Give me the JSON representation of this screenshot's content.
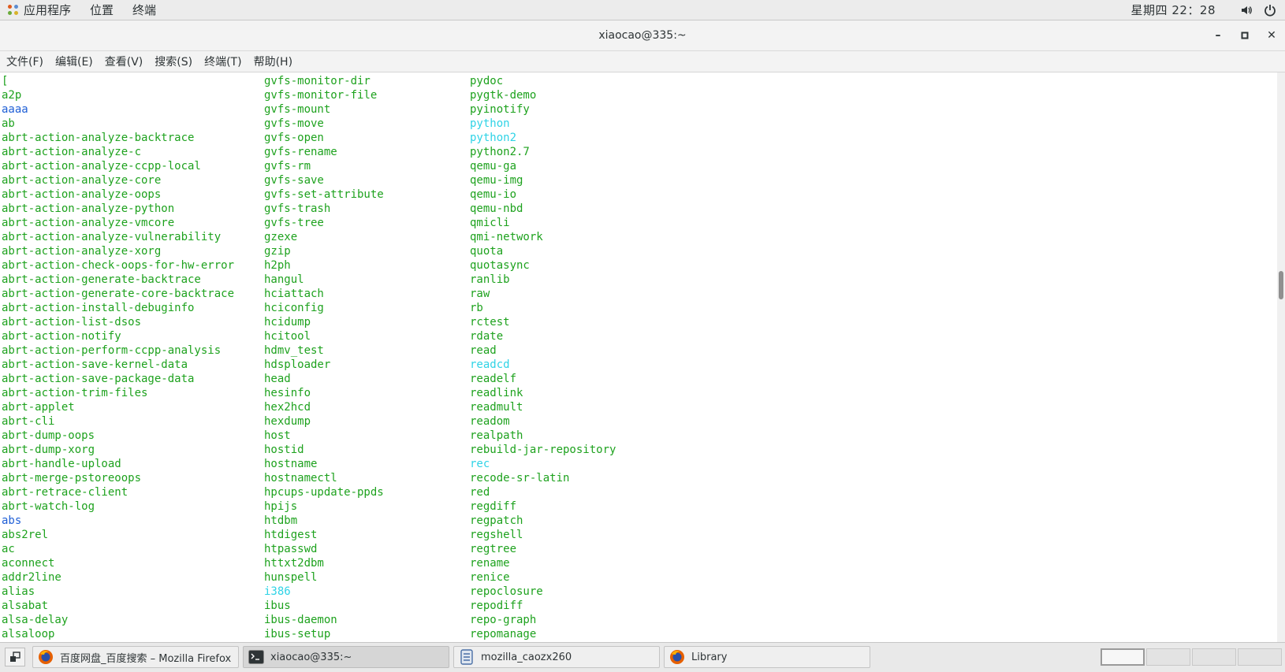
{
  "top_panel": {
    "apps_label": "应用程序",
    "places_label": "位置",
    "terminal_label": "终端",
    "clock": "星期四 22：28"
  },
  "window": {
    "title": "xiaocao@335:~",
    "minimize": "–",
    "maximize": "▫",
    "close": "✕"
  },
  "menubar": {
    "items": [
      "文件(F)",
      "编辑(E)",
      "查看(V)",
      "搜索(S)",
      "终端(T)",
      "帮助(H)"
    ]
  },
  "terminal": {
    "colors": {
      "green": "#1ea21e",
      "blue": "#1f5fd6",
      "cyan": "#2fd3e6"
    },
    "columns": [
      [
        {
          "t": "[",
          "c": "green"
        },
        {
          "t": "a2p",
          "c": "green"
        },
        {
          "t": "aaaa",
          "c": "blue"
        },
        {
          "t": "ab",
          "c": "green"
        },
        {
          "t": "abrt-action-analyze-backtrace",
          "c": "green"
        },
        {
          "t": "abrt-action-analyze-c",
          "c": "green"
        },
        {
          "t": "abrt-action-analyze-ccpp-local",
          "c": "green"
        },
        {
          "t": "abrt-action-analyze-core",
          "c": "green"
        },
        {
          "t": "abrt-action-analyze-oops",
          "c": "green"
        },
        {
          "t": "abrt-action-analyze-python",
          "c": "green"
        },
        {
          "t": "abrt-action-analyze-vmcore",
          "c": "green"
        },
        {
          "t": "abrt-action-analyze-vulnerability",
          "c": "green"
        },
        {
          "t": "abrt-action-analyze-xorg",
          "c": "green"
        },
        {
          "t": "abrt-action-check-oops-for-hw-error",
          "c": "green"
        },
        {
          "t": "abrt-action-generate-backtrace",
          "c": "green"
        },
        {
          "t": "abrt-action-generate-core-backtrace",
          "c": "green"
        },
        {
          "t": "abrt-action-install-debuginfo",
          "c": "green"
        },
        {
          "t": "abrt-action-list-dsos",
          "c": "green"
        },
        {
          "t": "abrt-action-notify",
          "c": "green"
        },
        {
          "t": "abrt-action-perform-ccpp-analysis",
          "c": "green"
        },
        {
          "t": "abrt-action-save-kernel-data",
          "c": "green"
        },
        {
          "t": "abrt-action-save-package-data",
          "c": "green"
        },
        {
          "t": "abrt-action-trim-files",
          "c": "green"
        },
        {
          "t": "abrt-applet",
          "c": "green"
        },
        {
          "t": "abrt-cli",
          "c": "green"
        },
        {
          "t": "abrt-dump-oops",
          "c": "green"
        },
        {
          "t": "abrt-dump-xorg",
          "c": "green"
        },
        {
          "t": "abrt-handle-upload",
          "c": "green"
        },
        {
          "t": "abrt-merge-pstoreoops",
          "c": "green"
        },
        {
          "t": "abrt-retrace-client",
          "c": "green"
        },
        {
          "t": "abrt-watch-log",
          "c": "green"
        },
        {
          "t": "abs",
          "c": "blue"
        },
        {
          "t": "abs2rel",
          "c": "green"
        },
        {
          "t": "ac",
          "c": "green"
        },
        {
          "t": "aconnect",
          "c": "green"
        },
        {
          "t": "addr2line",
          "c": "green"
        },
        {
          "t": "alias",
          "c": "green"
        },
        {
          "t": "alsabat",
          "c": "green"
        },
        {
          "t": "alsa-delay",
          "c": "green"
        },
        {
          "t": "alsaloop",
          "c": "green"
        }
      ],
      [
        {
          "t": "gvfs-monitor-dir",
          "c": "green"
        },
        {
          "t": "gvfs-monitor-file",
          "c": "green"
        },
        {
          "t": "gvfs-mount",
          "c": "green"
        },
        {
          "t": "gvfs-move",
          "c": "green"
        },
        {
          "t": "gvfs-open",
          "c": "green"
        },
        {
          "t": "gvfs-rename",
          "c": "green"
        },
        {
          "t": "gvfs-rm",
          "c": "green"
        },
        {
          "t": "gvfs-save",
          "c": "green"
        },
        {
          "t": "gvfs-set-attribute",
          "c": "green"
        },
        {
          "t": "gvfs-trash",
          "c": "green"
        },
        {
          "t": "gvfs-tree",
          "c": "green"
        },
        {
          "t": "gzexe",
          "c": "green"
        },
        {
          "t": "gzip",
          "c": "green"
        },
        {
          "t": "h2ph",
          "c": "green"
        },
        {
          "t": "hangul",
          "c": "green"
        },
        {
          "t": "hciattach",
          "c": "green"
        },
        {
          "t": "hciconfig",
          "c": "green"
        },
        {
          "t": "hcidump",
          "c": "green"
        },
        {
          "t": "hcitool",
          "c": "green"
        },
        {
          "t": "hdmv_test",
          "c": "green"
        },
        {
          "t": "hdsploader",
          "c": "green"
        },
        {
          "t": "head",
          "c": "green"
        },
        {
          "t": "hesinfo",
          "c": "green"
        },
        {
          "t": "hex2hcd",
          "c": "green"
        },
        {
          "t": "hexdump",
          "c": "green"
        },
        {
          "t": "host",
          "c": "green"
        },
        {
          "t": "hostid",
          "c": "green"
        },
        {
          "t": "hostname",
          "c": "green"
        },
        {
          "t": "hostnamectl",
          "c": "green"
        },
        {
          "t": "hpcups-update-ppds",
          "c": "green"
        },
        {
          "t": "hpijs",
          "c": "green"
        },
        {
          "t": "htdbm",
          "c": "green"
        },
        {
          "t": "htdigest",
          "c": "green"
        },
        {
          "t": "htpasswd",
          "c": "green"
        },
        {
          "t": "httxt2dbm",
          "c": "green"
        },
        {
          "t": "hunspell",
          "c": "green"
        },
        {
          "t": "i386",
          "c": "cyan"
        },
        {
          "t": "ibus",
          "c": "green"
        },
        {
          "t": "ibus-daemon",
          "c": "green"
        },
        {
          "t": "ibus-setup",
          "c": "green"
        }
      ],
      [
        {
          "t": "pydoc",
          "c": "green"
        },
        {
          "t": "pygtk-demo",
          "c": "green"
        },
        {
          "t": "pyinotify",
          "c": "green"
        },
        {
          "t": "python",
          "c": "cyan"
        },
        {
          "t": "python2",
          "c": "cyan"
        },
        {
          "t": "python2.7",
          "c": "green"
        },
        {
          "t": "qemu-ga",
          "c": "green"
        },
        {
          "t": "qemu-img",
          "c": "green"
        },
        {
          "t": "qemu-io",
          "c": "green"
        },
        {
          "t": "qemu-nbd",
          "c": "green"
        },
        {
          "t": "qmicli",
          "c": "green"
        },
        {
          "t": "qmi-network",
          "c": "green"
        },
        {
          "t": "quota",
          "c": "green"
        },
        {
          "t": "quotasync",
          "c": "green"
        },
        {
          "t": "ranlib",
          "c": "green"
        },
        {
          "t": "raw",
          "c": "green"
        },
        {
          "t": "rb",
          "c": "green"
        },
        {
          "t": "rctest",
          "c": "green"
        },
        {
          "t": "rdate",
          "c": "green"
        },
        {
          "t": "read",
          "c": "green"
        },
        {
          "t": "readcd",
          "c": "cyan"
        },
        {
          "t": "readelf",
          "c": "green"
        },
        {
          "t": "readlink",
          "c": "green"
        },
        {
          "t": "readmult",
          "c": "green"
        },
        {
          "t": "readom",
          "c": "green"
        },
        {
          "t": "realpath",
          "c": "green"
        },
        {
          "t": "rebuild-jar-repository",
          "c": "green"
        },
        {
          "t": "rec",
          "c": "cyan"
        },
        {
          "t": "recode-sr-latin",
          "c": "green"
        },
        {
          "t": "red",
          "c": "green"
        },
        {
          "t": "regdiff",
          "c": "green"
        },
        {
          "t": "regpatch",
          "c": "green"
        },
        {
          "t": "regshell",
          "c": "green"
        },
        {
          "t": "regtree",
          "c": "green"
        },
        {
          "t": "rename",
          "c": "green"
        },
        {
          "t": "renice",
          "c": "green"
        },
        {
          "t": "repoclosure",
          "c": "green"
        },
        {
          "t": "repodiff",
          "c": "green"
        },
        {
          "t": "repo-graph",
          "c": "green"
        },
        {
          "t": "repomanage",
          "c": "green"
        }
      ]
    ]
  },
  "taskbar": {
    "tasks": [
      {
        "label": "百度网盘_百度搜索 – Mozilla Firefox",
        "icon": "firefox-icon"
      },
      {
        "label": "xiaocao@335:~",
        "icon": "terminal-icon"
      },
      {
        "label": "mozilla_caozx260",
        "icon": "file-manager-icon"
      },
      {
        "label": "Library",
        "icon": "firefox-icon"
      }
    ]
  }
}
